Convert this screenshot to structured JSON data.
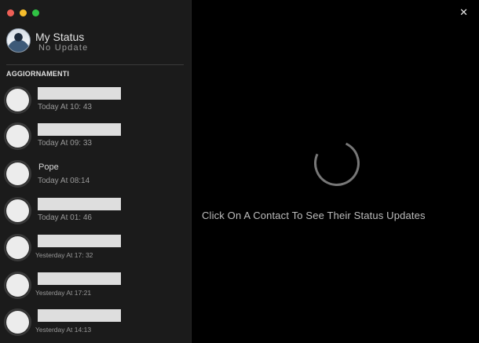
{
  "window": {
    "controls": [
      "close",
      "minimize",
      "maximize"
    ]
  },
  "sidebar": {
    "my_status": {
      "title": "My Status",
      "subtitle": "No Update"
    },
    "section_title": "AGGIORNAMENTI",
    "contacts": [
      {
        "name": "",
        "time": "Today At 10: 43"
      },
      {
        "name": "",
        "time": "Today At 09: 33"
      },
      {
        "name": "Pope",
        "time": "Today At 08:14"
      },
      {
        "name": "",
        "time": "Today At 01: 46"
      },
      {
        "name": "",
        "time": "Yesterday At 17: 32"
      },
      {
        "name": "",
        "time": "Yesterday At 17:21"
      },
      {
        "name": "",
        "time": "Yesterday At 14:13"
      }
    ]
  },
  "main": {
    "close_icon": "close-icon",
    "spinner_icon": "loading-spinner-icon",
    "hint": "Click On A Contact To See Their Status Updates"
  },
  "colors": {
    "sidebar_bg": "#1b1b1b",
    "main_bg": "#000000"
  }
}
